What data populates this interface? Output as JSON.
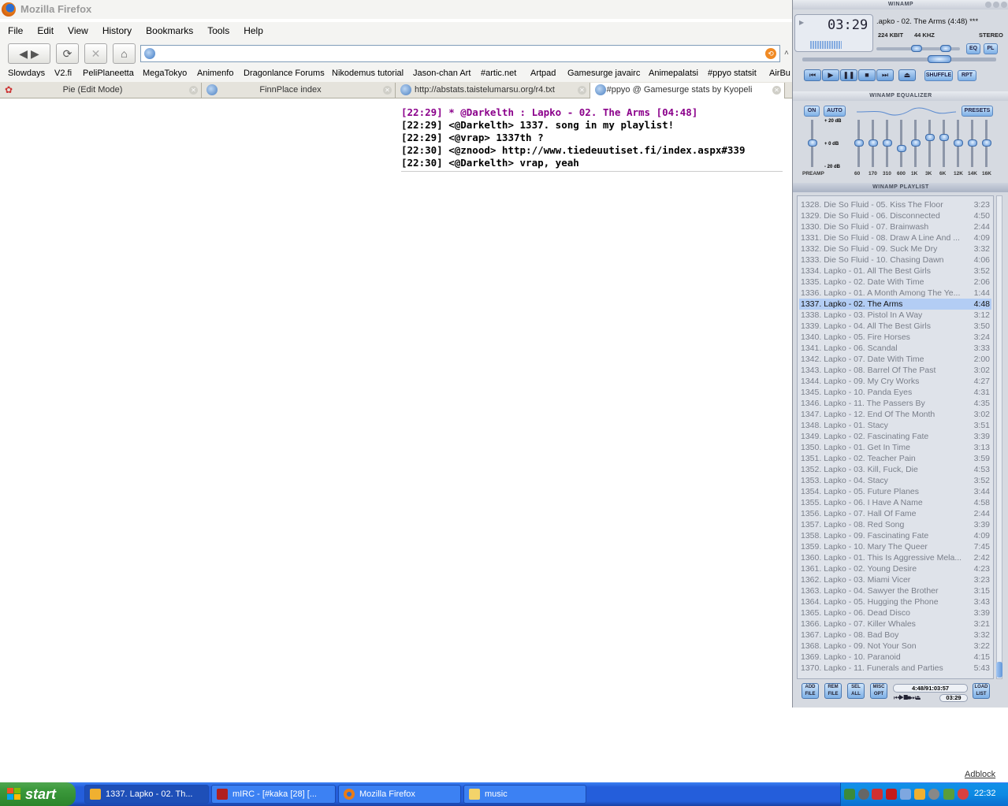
{
  "firefox": {
    "title": "Mozilla Firefox",
    "menu": [
      "File",
      "Edit",
      "View",
      "History",
      "Bookmarks",
      "Tools",
      "Help"
    ],
    "bookmarks": [
      "Slowdays",
      "V2.fi",
      "PeliPlaneetta",
      "MegaTokyo",
      "Animenfo",
      "Dragonlance Forums",
      "Nikodemus tutorial",
      "Jason-chan Art",
      "#artic.net",
      "Artpad",
      "Gamesurge javairc",
      "Animepalatsi",
      "#ppyo statsit",
      "AirBu"
    ],
    "tabs": [
      "Pie (Edit Mode)",
      "FinnPlace index",
      "http://abstats.taistelumarsu.org/r4.txt",
      "#ppyo @ Gamesurge stats by Kyopeli"
    ],
    "url": "",
    "irc_lines": [
      {
        "text": "[22:29] * @Darkelth : Lapko - 02. The Arms [04:48]",
        "color": "#8b008b"
      },
      {
        "text": "[22:29] <@Darkelth> 1337. song in my playlist!",
        "color": "#000000"
      },
      {
        "text": "[22:29] <@vrap> 1337th ?",
        "color": "#000000"
      },
      {
        "text": "[22:30] <@znood> http://www.tiedeuutiset.fi/index.aspx#339",
        "color": "#000000"
      },
      {
        "text": "[22:30] <@Darkelth> vrap, yeah",
        "color": "#000000"
      }
    ],
    "adblock": "Adblock"
  },
  "winamp": {
    "main_title": "WINAMP",
    "time": "03:29",
    "song": ".apko - 02. The Arms (4:48) ***",
    "kbit": "224 KBIT",
    "khz": "44 KHZ",
    "stereo": "STEREO",
    "eq_btn": "EQ",
    "pl_btn": "PL",
    "shuffle": "SHUFFLE",
    "repeat": "RPT",
    "eq_title": "WINAMP EQUALIZER",
    "eq_on": "ON",
    "eq_auto": "AUTO",
    "eq_presets": "PRESETS",
    "eq_db_top": "+ 20 dB",
    "eq_db_mid": "+ 0 dB",
    "eq_db_bot": "- 20 dB",
    "eq_preamp": "PREAMP",
    "eq_bands": [
      "60",
      "170",
      "310",
      "600",
      "1K",
      "3K",
      "6K",
      "12K",
      "14K",
      "16K"
    ],
    "eq_levels": [
      0.5,
      0.5,
      0.5,
      0.62,
      0.5,
      0.38,
      0.38,
      0.5,
      0.5,
      0.5
    ],
    "preamp_level": 0.5,
    "pl_title": "WINAMP PLAYLIST",
    "pl_total": "4:48/91:03:57",
    "pl_mini_time": "03:29",
    "pl_buttons": [
      [
        "ADD",
        "FILE"
      ],
      [
        "REM",
        "FILE"
      ],
      [
        "SEL",
        "ALL"
      ],
      [
        "MISC",
        "OPT"
      ],
      [
        "LOAD",
        "LIST"
      ]
    ],
    "selected_index": 9,
    "playlist": [
      {
        "t": "1328. Die So Fluid - 05. Kiss The Floor",
        "d": "3:23"
      },
      {
        "t": "1329. Die So Fluid - 06. Disconnected",
        "d": "4:50"
      },
      {
        "t": "1330. Die So Fluid - 07. Brainwash",
        "d": "2:44"
      },
      {
        "t": "1331. Die So Fluid - 08. Draw A Line And ...",
        "d": "4:09"
      },
      {
        "t": "1332. Die So Fluid - 09. Suck Me Dry",
        "d": "3:32"
      },
      {
        "t": "1333. Die So Fluid - 10. Chasing Dawn",
        "d": "4:06"
      },
      {
        "t": "1334. Lapko - 01. All The Best Girls",
        "d": "3:52"
      },
      {
        "t": "1335. Lapko - 02. Date With Time",
        "d": "2:06"
      },
      {
        "t": "1336. Lapko - 01. A Month Among The Ye...",
        "d": "1:44"
      },
      {
        "t": "1337. Lapko - 02. The Arms",
        "d": "4:48"
      },
      {
        "t": "1338. Lapko - 03. Pistol In A Way",
        "d": "3:12"
      },
      {
        "t": "1339. Lapko - 04. All The Best Girls",
        "d": "3:50"
      },
      {
        "t": "1340. Lapko - 05. Fire Horses",
        "d": "3:24"
      },
      {
        "t": "1341. Lapko - 06. Scandal",
        "d": "3:33"
      },
      {
        "t": "1342. Lapko - 07. Date With Time",
        "d": "2:00"
      },
      {
        "t": "1343. Lapko - 08. Barrel Of The Past",
        "d": "3:02"
      },
      {
        "t": "1344. Lapko - 09. My Cry Works",
        "d": "4:27"
      },
      {
        "t": "1345. Lapko - 10. Panda Eyes",
        "d": "4:31"
      },
      {
        "t": "1346. Lapko - 11. The Passers By",
        "d": "4:35"
      },
      {
        "t": "1347. Lapko - 12. End Of The Month",
        "d": "3:02"
      },
      {
        "t": "1348. Lapko - 01. Stacy",
        "d": "3:51"
      },
      {
        "t": "1349. Lapko - 02. Fascinating Fate",
        "d": "3:39"
      },
      {
        "t": "1350. Lapko - 01. Get In Time",
        "d": "3:13"
      },
      {
        "t": "1351. Lapko - 02. Teacher Pain",
        "d": "3:59"
      },
      {
        "t": "1352. Lapko - 03. Kill, Fuck, Die",
        "d": "4:53"
      },
      {
        "t": "1353. Lapko - 04. Stacy",
        "d": "3:52"
      },
      {
        "t": "1354. Lapko - 05. Future Planes",
        "d": "3:44"
      },
      {
        "t": "1355. Lapko - 06. I Have A Name",
        "d": "4:58"
      },
      {
        "t": "1356. Lapko - 07. Hall Of Fame",
        "d": "2:44"
      },
      {
        "t": "1357. Lapko - 08. Red Song",
        "d": "3:39"
      },
      {
        "t": "1358. Lapko - 09. Fascinating Fate",
        "d": "4:09"
      },
      {
        "t": "1359. Lapko - 10. Mary The Queer",
        "d": "7:45"
      },
      {
        "t": "1360. Lapko - 01. This Is Aggressive Mela...",
        "d": "2:42"
      },
      {
        "t": "1361. Lapko - 02. Young Desire",
        "d": "4:23"
      },
      {
        "t": "1362. Lapko - 03. Miami Vicer",
        "d": "3:23"
      },
      {
        "t": "1363. Lapko - 04. Sawyer the Brother",
        "d": "3:15"
      },
      {
        "t": "1364. Lapko - 05. Hugging the Phone",
        "d": "3:43"
      },
      {
        "t": "1365. Lapko - 06. Dead Disco",
        "d": "3:39"
      },
      {
        "t": "1366. Lapko - 07. Killer Whales",
        "d": "3:21"
      },
      {
        "t": "1367. Lapko - 08. Bad Boy",
        "d": "3:32"
      },
      {
        "t": "1368. Lapko - 09. Not Your Son",
        "d": "3:22"
      },
      {
        "t": "1369. Lapko - 10. Paranoid",
        "d": "4:15"
      },
      {
        "t": "1370. Lapko - 11. Funerals and Parties",
        "d": "5:43"
      }
    ]
  },
  "taskbar": {
    "start": "start",
    "items": [
      "1337. Lapko - 02. Th...",
      "mIRC - [#kaka [28] [...",
      "Mozilla Firefox",
      "music"
    ],
    "clock": "22:32"
  }
}
